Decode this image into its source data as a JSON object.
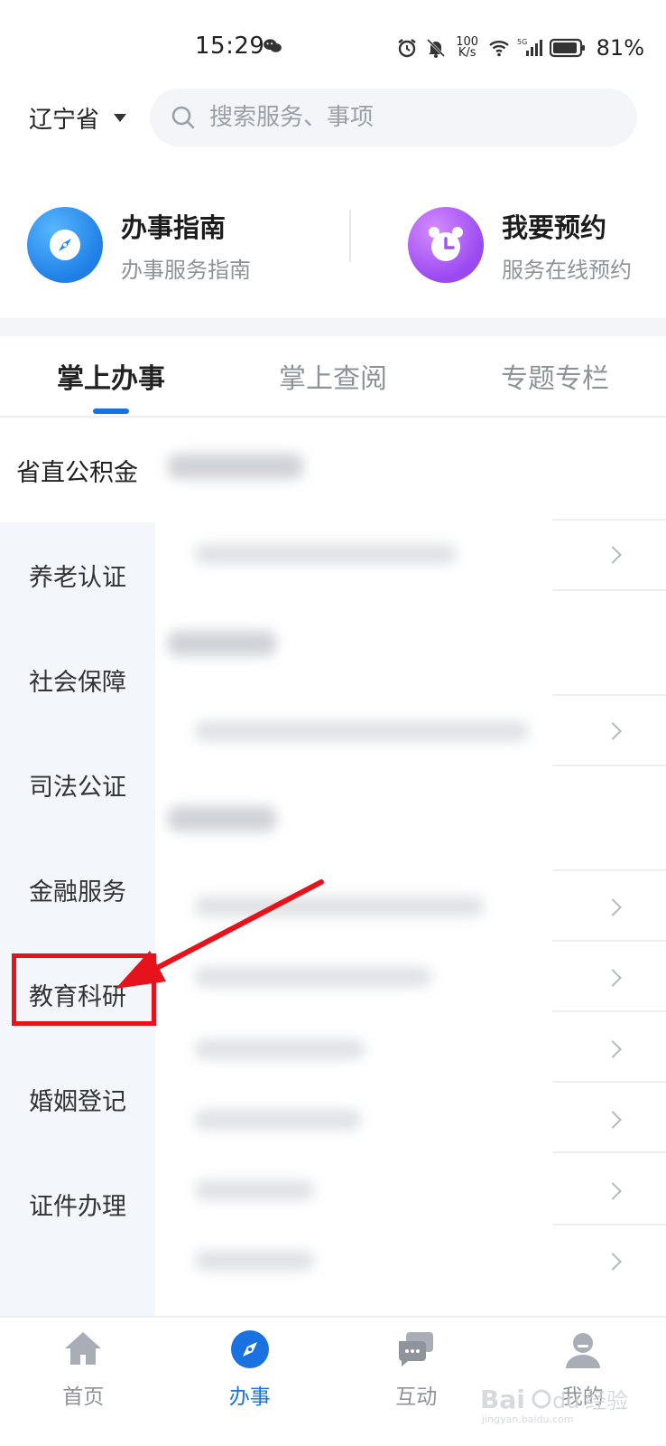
{
  "status_bar": {
    "time": "15:29",
    "net_speed_top": "100",
    "net_speed_bottom": "K/s",
    "battery": "81%"
  },
  "header": {
    "region": "辽宁省",
    "search_placeholder": "搜索服务、事项"
  },
  "quick_cards": [
    {
      "title": "办事指南",
      "subtitle": "办事服务指南",
      "icon": "compass-icon",
      "color": "#1f7fe6"
    },
    {
      "title": "我要预约",
      "subtitle": "服务在线预约",
      "icon": "alarm-clock-icon",
      "color": "#9a48f0"
    }
  ],
  "tabs": [
    {
      "label": "掌上办事",
      "active": true
    },
    {
      "label": "掌上查阅",
      "active": false
    },
    {
      "label": "专题专栏",
      "active": false
    }
  ],
  "categories": [
    {
      "label": "省直公积金",
      "active": true
    },
    {
      "label": "养老认证",
      "active": false
    },
    {
      "label": "社会保障",
      "active": false
    },
    {
      "label": "司法公证",
      "active": false
    },
    {
      "label": "金融服务",
      "active": false
    },
    {
      "label": "教育科研",
      "active": false,
      "highlighted": true
    },
    {
      "label": "婚姻登记",
      "active": false
    },
    {
      "label": "证件办理",
      "active": false
    }
  ],
  "bottom_nav": [
    {
      "label": "首页",
      "icon": "home-icon",
      "active": false
    },
    {
      "label": "办事",
      "icon": "compass-icon",
      "active": true
    },
    {
      "label": "互动",
      "icon": "chat-icon",
      "active": false
    },
    {
      "label": "我的",
      "icon": "user-icon",
      "active": false
    }
  ],
  "colors": {
    "accent": "#1a72e0",
    "annotation": "#e5131b",
    "nav_bg": "#f3f6fa"
  }
}
